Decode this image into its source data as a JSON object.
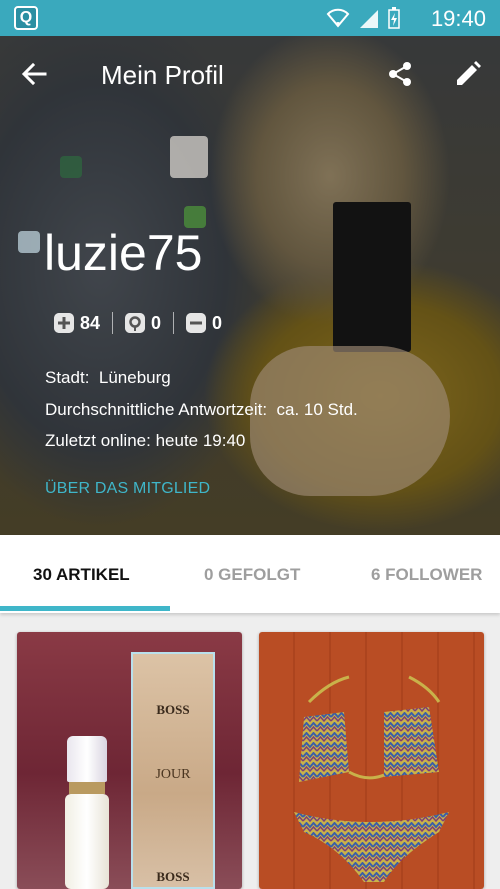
{
  "status_bar": {
    "time": "19:40",
    "app_icon_letter": "Q"
  },
  "app_bar": {
    "title": "Mein Profil",
    "back_icon": "arrow-left-icon",
    "share_icon": "share-icon",
    "edit_icon": "pencil-icon"
  },
  "profile": {
    "username": "luzie75",
    "stats": [
      {
        "icon": "plus-icon",
        "value": "84"
      },
      {
        "icon": "badge-icon",
        "value": "0"
      },
      {
        "icon": "minus-icon",
        "value": "0"
      }
    ],
    "city_label": "Stadt:",
    "city_value": "Lüneburg",
    "response_label": "Durchschnittliche Antwortzeit:",
    "response_value": "ca. 10 Std.",
    "online_label": "Zuletzt online:",
    "online_value": "heute 19:40",
    "about_link": "ÜBER DAS MITGLIED"
  },
  "tabs": [
    {
      "label": "30 ARTIKEL",
      "active": true
    },
    {
      "label": "0 GEFOLGT",
      "active": false
    },
    {
      "label": "6 FOLLOWER",
      "active": false
    }
  ],
  "items": [
    {
      "image": "perfume",
      "box_brand": "BOSS",
      "box_name": "JOUR"
    },
    {
      "image": "bikini"
    }
  ],
  "colors": {
    "status_bar": "#3aa9bd",
    "accent": "#3fb6c9"
  }
}
